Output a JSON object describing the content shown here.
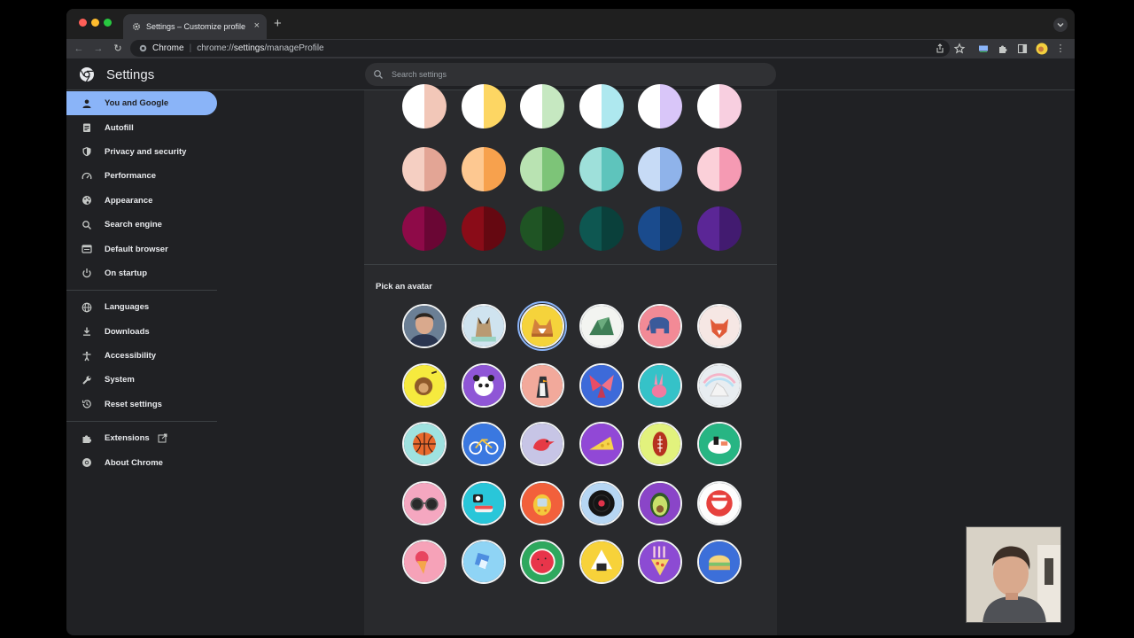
{
  "browser": {
    "tab_title": "Settings – Customize profile",
    "omnibox_origin": "Chrome",
    "url_prefix": "chrome://",
    "url_host": "settings",
    "url_path": "/manageProfile"
  },
  "header": {
    "title": "Settings",
    "search_placeholder": "Search settings"
  },
  "sidebar": {
    "items": [
      {
        "label": "You and Google",
        "icon": "person-icon",
        "active": true
      },
      {
        "label": "Autofill",
        "icon": "clipboard-icon"
      },
      {
        "label": "Privacy and security",
        "icon": "shield-icon"
      },
      {
        "label": "Performance",
        "icon": "speedometer-icon"
      },
      {
        "label": "Appearance",
        "icon": "palette-icon"
      },
      {
        "label": "Search engine",
        "icon": "search-icon"
      },
      {
        "label": "Default browser",
        "icon": "browser-icon"
      },
      {
        "label": "On startup",
        "icon": "power-icon"
      },
      {
        "label": "Languages",
        "icon": "globe-icon"
      },
      {
        "label": "Downloads",
        "icon": "download-icon"
      },
      {
        "label": "Accessibility",
        "icon": "accessibility-icon"
      },
      {
        "label": "System",
        "icon": "wrench-icon"
      },
      {
        "label": "Reset settings",
        "icon": "history-icon"
      },
      {
        "label": "Extensions",
        "icon": "puzzle-icon"
      },
      {
        "label": "About Chrome",
        "icon": "chrome-icon"
      }
    ]
  },
  "theme_colors": {
    "row1": [
      [
        "#ffffff",
        "#f2c7b8"
      ],
      [
        "#ffffff",
        "#fdd663"
      ],
      [
        "#ffffff",
        "#c6e8c1"
      ],
      [
        "#ffffff",
        "#aee8ef"
      ],
      [
        "#ffffff",
        "#d9c6f9"
      ],
      [
        "#ffffff",
        "#f8cfe0"
      ]
    ],
    "row2": [
      [
        "#f5cfc2",
        "#e3a595"
      ],
      [
        "#fdc891",
        "#f7a14d"
      ],
      [
        "#b9e3b2",
        "#7dc478"
      ],
      [
        "#9ee0da",
        "#5ec4bc"
      ],
      [
        "#c7dbf6",
        "#8fb3ea"
      ],
      [
        "#fbd0d9",
        "#f59ab3"
      ]
    ],
    "row3": [
      [
        "#8e0a48",
        "#6a0634"
      ],
      [
        "#8a0c18",
        "#650811"
      ],
      [
        "#1f5424",
        "#163d1a"
      ],
      [
        "#0e5751",
        "#0a403b"
      ],
      [
        "#1a4b8d",
        "#133868"
      ],
      [
        "#5b2696",
        "#421b70"
      ]
    ]
  },
  "avatar_section": {
    "title": "Pick an avatar",
    "avatars": [
      "photo-avatar",
      "cat-avatar",
      "corgi-avatar",
      "dragon-avatar",
      "elephant-avatar",
      "fox-avatar",
      "monkey-avatar",
      "panda-avatar",
      "penguin-avatar",
      "butterfly-avatar",
      "rabbit-avatar",
      "unicorn-avatar",
      "basketball-avatar",
      "bike-avatar",
      "bird-avatar",
      "cheese-avatar",
      "football-avatar",
      "sushi-plate-avatar",
      "sunglasses-avatar",
      "sushi-avatar",
      "tamagotchi-avatar",
      "vinyl-avatar",
      "avocado-avatar",
      "smile-avatar",
      "ice-cream-avatar",
      "ice-cube-avatar",
      "watermelon-avatar",
      "onigiri-avatar",
      "pizza-avatar",
      "sandwich-avatar"
    ],
    "selected": "corgi-avatar"
  },
  "colors": {
    "accent": "#8ab4f8",
    "background": "#202124",
    "card": "#292a2d"
  }
}
